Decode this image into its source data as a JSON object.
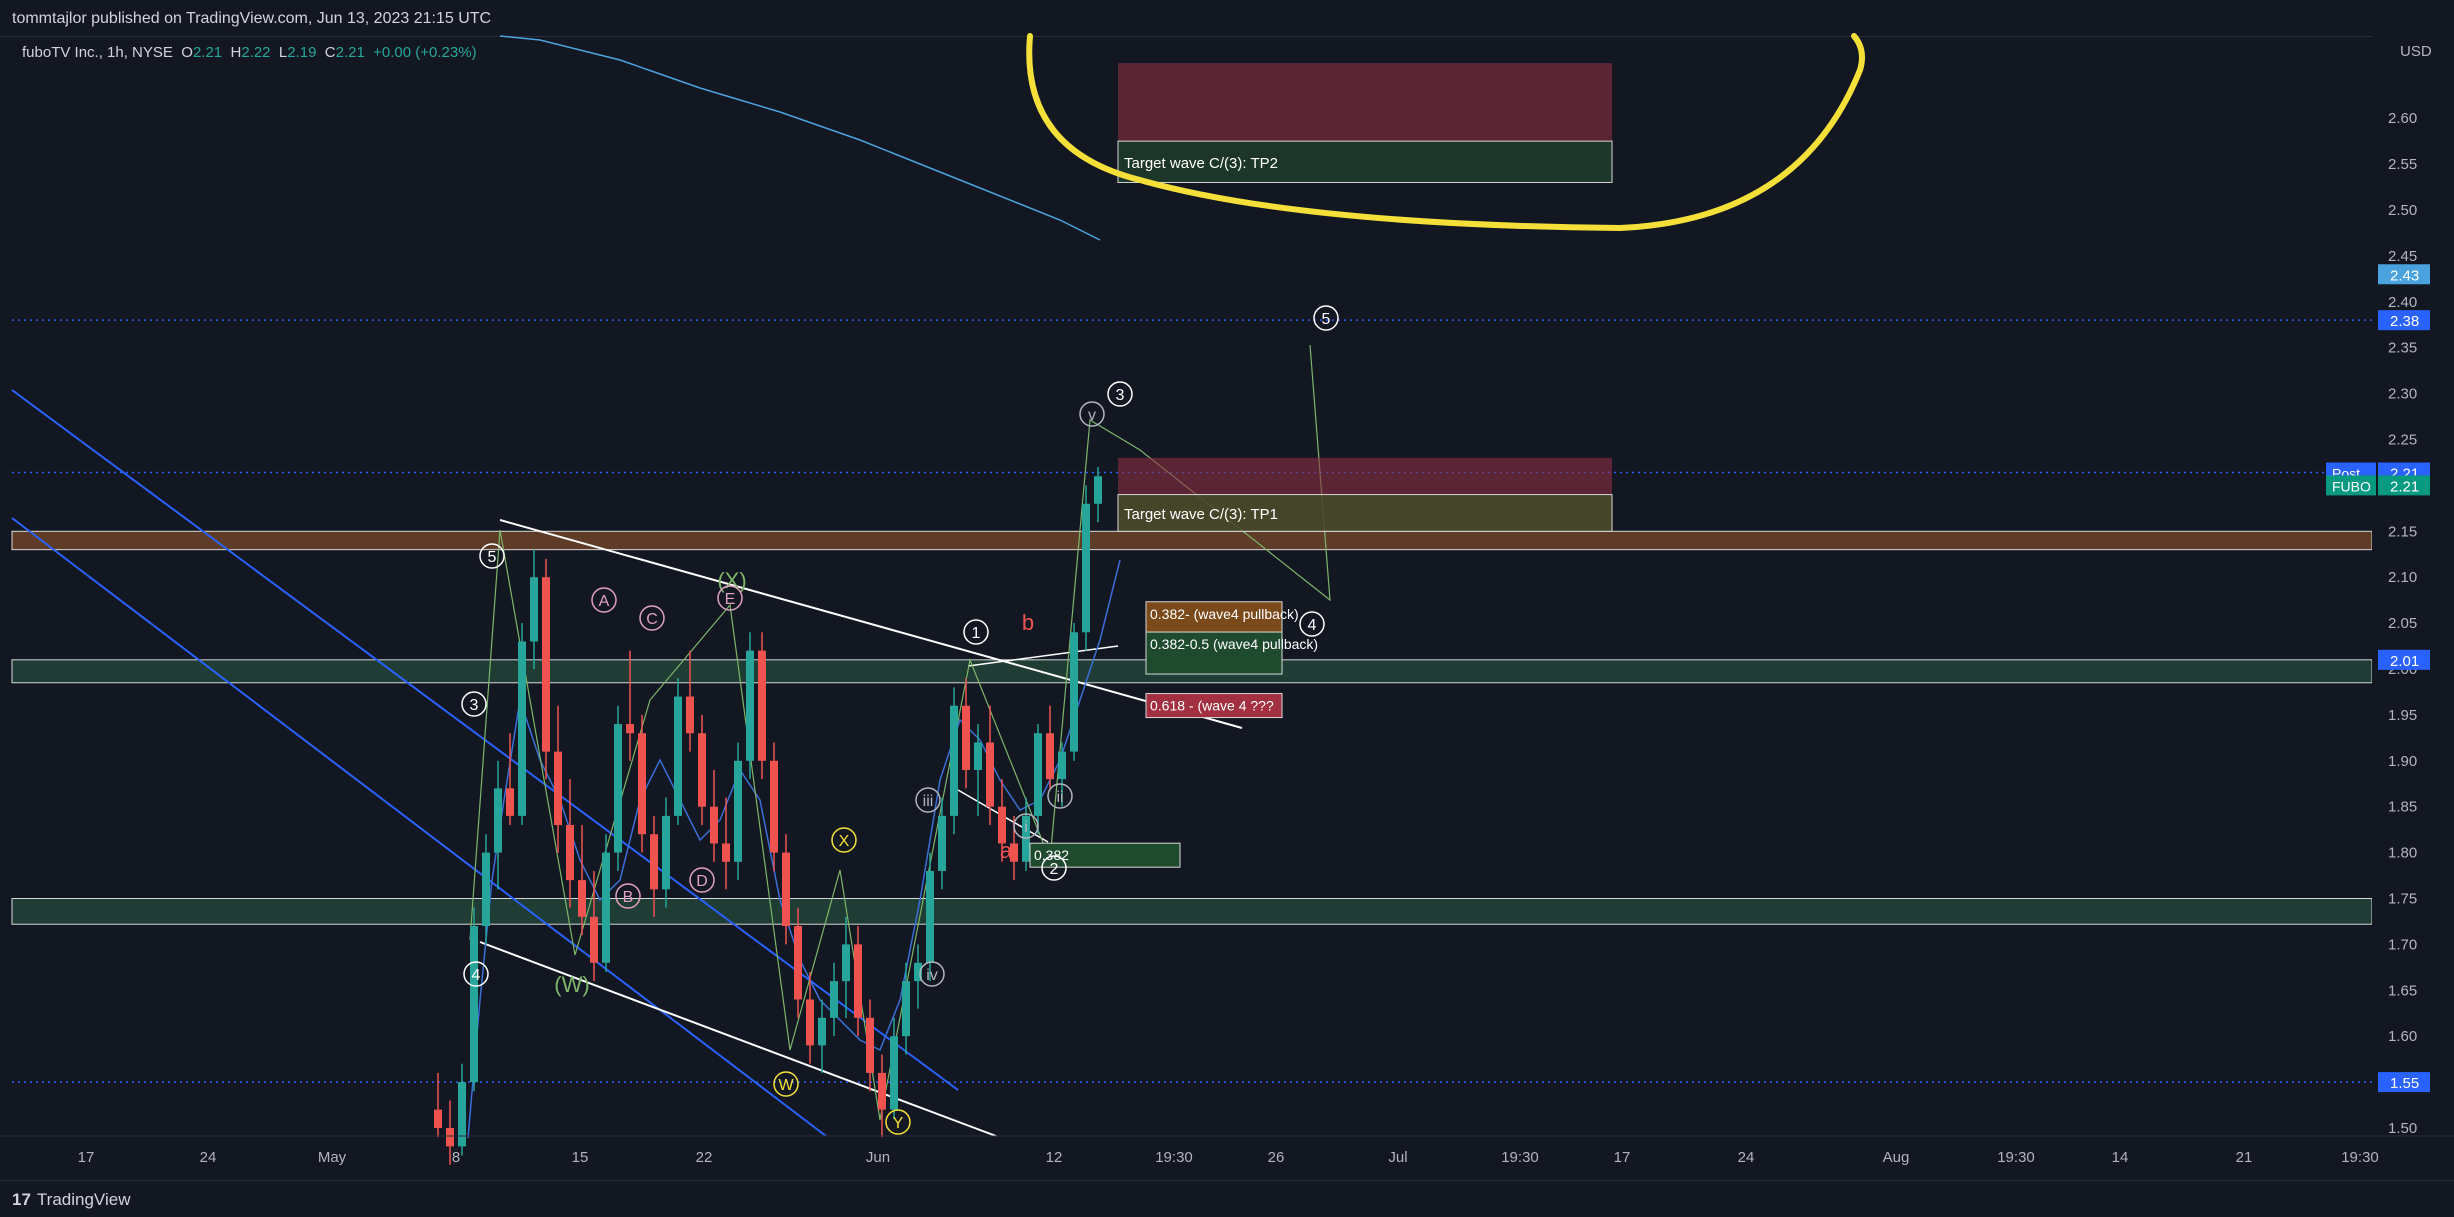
{
  "header": {
    "published": "tommtajlor published on TradingView.com, Jun 13, 2023 21:15 UTC"
  },
  "symbol": {
    "title": "fuboTV Inc., 1h, NYSE",
    "o_label": "O",
    "o": "2.21",
    "h_label": "H",
    "h": "2.22",
    "l_label": "L",
    "l": "2.19",
    "c_label": "C",
    "c": "2.21",
    "change": "+0.00 (+0.23%)"
  },
  "footer": {
    "brand": "TradingView"
  },
  "colors": {
    "up": "#26a69a",
    "down": "#ef5350",
    "background": "#131722",
    "axis_text": "#b2b5be",
    "highlight": "#f5e03a"
  },
  "chart_data": {
    "type": "candlestick",
    "currency": "USD",
    "ylim": [
      1.46,
      2.66
    ],
    "y_ticks": [
      "1.50",
      "1.55",
      "1.60",
      "1.65",
      "1.70",
      "1.75",
      "1.80",
      "1.85",
      "1.90",
      "1.95",
      "2.00",
      "2.05",
      "2.10",
      "2.15",
      "2.20",
      "2.25",
      "2.30",
      "2.35",
      "2.40",
      "2.45",
      "2.50",
      "2.55",
      "2.60"
    ],
    "x_ticks": [
      "17",
      "24",
      "May",
      "8",
      "15",
      "22",
      "Jun",
      "12",
      "19:30",
      "26",
      "Jul",
      "19:30",
      "17",
      "24",
      "Aug",
      "19:30",
      "14",
      "21",
      "19:30"
    ],
    "price_labels": [
      {
        "text": "2.43",
        "value": 2.43,
        "color": "#4aa3df"
      },
      {
        "text": "2.38",
        "value": 2.38,
        "color": "#2962ff"
      },
      {
        "text": "2.21",
        "value": 2.214,
        "color": "#2962ff"
      },
      {
        "text": "2.21",
        "value": 2.2,
        "color": "#089981"
      },
      {
        "text": "2.01",
        "value": 2.01,
        "color": "#2962ff"
      },
      {
        "text": "1.55",
        "value": 1.55,
        "color": "#2962ff"
      }
    ],
    "side_tags": [
      {
        "text": "Post",
        "value": 2.214,
        "color": "#2962ff"
      },
      {
        "text": "FUBO",
        "value": 2.2,
        "color": "#089981"
      }
    ],
    "hlines": [
      2.38,
      1.55,
      2.214
    ],
    "zones": [
      {
        "y1": 2.13,
        "y2": 2.15,
        "color": "#c8702f",
        "opacity": 0.42,
        "full": true
      },
      {
        "y1": 1.985,
        "y2": 2.01,
        "color": "#2e6b4d",
        "opacity": 0.45,
        "full": true
      },
      {
        "y1": 1.722,
        "y2": 1.75,
        "color": "#2e6b4d",
        "opacity": 0.45,
        "full": true
      }
    ],
    "boxes": [
      {
        "label": "Target wave C/(3): TP2",
        "y1": 2.53,
        "y2": 2.66,
        "top_color": "#8c2f43",
        "split": 2.575
      },
      {
        "label": "Target wave C/(3): TP1",
        "y1": 2.15,
        "y2": 2.23,
        "top_color": "#8c2f43",
        "split": 2.19
      }
    ],
    "fib_labels": [
      {
        "text": "0.382- (wave4 pullback)",
        "value": 2.058,
        "color": "#7a4a1a"
      },
      {
        "text": "0.382-0.5 (wave4 pullback)",
        "value": 2.025,
        "color": "#1e4a2e"
      },
      {
        "text": "0.618 - (wave 4 ???",
        "value": 1.958,
        "color": "#a33041"
      },
      {
        "text": "0.382",
        "value": 1.795,
        "color": "#1e4a2e"
      }
    ],
    "wave_labels": [
      "5",
      "3",
      "4",
      "1",
      "2",
      "3",
      "4",
      "5",
      "(X)",
      "(W)",
      "W",
      "X",
      "Y",
      "i",
      "ii",
      "iii",
      "iv",
      "v",
      "A",
      "B",
      "C",
      "D",
      "E",
      "a",
      "b"
    ],
    "candles": [
      [
        1.52,
        1.56,
        1.49,
        1.5
      ],
      [
        1.5,
        1.53,
        1.46,
        1.48
      ],
      [
        1.48,
        1.57,
        1.47,
        1.55
      ],
      [
        1.55,
        1.74,
        1.54,
        1.72
      ],
      [
        1.72,
        1.82,
        1.7,
        1.8
      ],
      [
        1.8,
        1.9,
        1.76,
        1.87
      ],
      [
        1.87,
        1.93,
        1.83,
        1.84
      ],
      [
        1.84,
        2.05,
        1.83,
        2.03
      ],
      [
        2.03,
        2.13,
        2.0,
        2.1
      ],
      [
        2.1,
        2.12,
        1.88,
        1.91
      ],
      [
        1.91,
        1.96,
        1.8,
        1.83
      ],
      [
        1.83,
        1.88,
        1.74,
        1.77
      ],
      [
        1.77,
        1.83,
        1.71,
        1.73
      ],
      [
        1.73,
        1.78,
        1.66,
        1.68
      ],
      [
        1.68,
        1.82,
        1.67,
        1.8
      ],
      [
        1.8,
        1.96,
        1.78,
        1.94
      ],
      [
        1.94,
        2.02,
        1.9,
        1.93
      ],
      [
        1.93,
        1.95,
        1.8,
        1.82
      ],
      [
        1.82,
        1.84,
        1.73,
        1.76
      ],
      [
        1.76,
        1.86,
        1.74,
        1.84
      ],
      [
        1.84,
        1.99,
        1.83,
        1.97
      ],
      [
        1.97,
        2.02,
        1.91,
        1.93
      ],
      [
        1.93,
        1.95,
        1.83,
        1.85
      ],
      [
        1.85,
        1.89,
        1.79,
        1.81
      ],
      [
        1.81,
        1.86,
        1.76,
        1.79
      ],
      [
        1.79,
        1.92,
        1.77,
        1.9
      ],
      [
        1.9,
        2.04,
        1.88,
        2.02
      ],
      [
        2.02,
        2.04,
        1.88,
        1.9
      ],
      [
        1.9,
        1.92,
        1.78,
        1.8
      ],
      [
        1.8,
        1.82,
        1.7,
        1.72
      ],
      [
        1.72,
        1.74,
        1.62,
        1.64
      ],
      [
        1.64,
        1.67,
        1.57,
        1.59
      ],
      [
        1.59,
        1.64,
        1.56,
        1.62
      ],
      [
        1.62,
        1.68,
        1.6,
        1.66
      ],
      [
        1.66,
        1.73,
        1.62,
        1.7
      ],
      [
        1.7,
        1.72,
        1.6,
        1.62
      ],
      [
        1.62,
        1.64,
        1.54,
        1.56
      ],
      [
        1.56,
        1.58,
        1.49,
        1.52
      ],
      [
        1.52,
        1.62,
        1.51,
        1.6
      ],
      [
        1.6,
        1.68,
        1.58,
        1.66
      ],
      [
        1.66,
        1.7,
        1.63,
        1.68
      ],
      [
        1.68,
        1.8,
        1.66,
        1.78
      ],
      [
        1.78,
        1.86,
        1.76,
        1.84
      ],
      [
        1.84,
        1.98,
        1.82,
        1.96
      ],
      [
        1.96,
        1.99,
        1.87,
        1.89
      ],
      [
        1.89,
        1.94,
        1.84,
        1.92
      ],
      [
        1.92,
        1.96,
        1.83,
        1.85
      ],
      [
        1.85,
        1.88,
        1.79,
        1.81
      ],
      [
        1.81,
        1.84,
        1.77,
        1.79
      ],
      [
        1.79,
        1.86,
        1.78,
        1.84
      ],
      [
        1.84,
        1.94,
        1.82,
        1.93
      ],
      [
        1.93,
        1.96,
        1.87,
        1.88
      ],
      [
        1.88,
        1.92,
        1.85,
        1.91
      ],
      [
        1.91,
        2.05,
        1.9,
        2.04
      ],
      [
        2.04,
        2.2,
        2.02,
        2.18
      ],
      [
        2.18,
        2.22,
        2.16,
        2.21
      ]
    ]
  }
}
